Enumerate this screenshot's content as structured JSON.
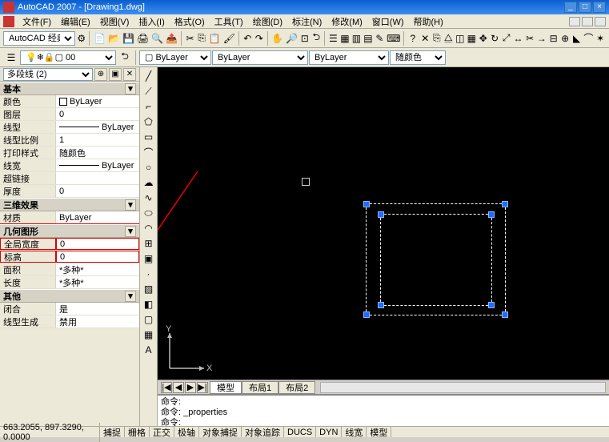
{
  "title": "AutoCAD 2007 - [Drawing1.dwg]",
  "menus": [
    "文件(F)",
    "编辑(E)",
    "视图(V)",
    "插入(I)",
    "格式(O)",
    "工具(T)",
    "绘图(D)",
    "标注(N)",
    "修改(M)",
    "窗口(W)",
    "帮助(H)"
  ],
  "workspace": "AutoCAD 经典",
  "layer_dropdown": "0",
  "linetype_dropdown": "ByLayer",
  "lineweight_dropdown": "ByLayer",
  "color_dropdown": "随颜色",
  "props": {
    "selector": "多段线 (2)",
    "groups": [
      {
        "name": "基本",
        "rows": [
          {
            "label": "颜色",
            "value": "ByLayer",
            "swatch": true
          },
          {
            "label": "图层",
            "value": "0"
          },
          {
            "label": "线型",
            "value": "ByLayer",
            "line": true
          },
          {
            "label": "线型比例",
            "value": "1"
          },
          {
            "label": "打印样式",
            "value": "随颜色"
          },
          {
            "label": "线宽",
            "value": "ByLayer",
            "line": true
          },
          {
            "label": "超链接",
            "value": ""
          },
          {
            "label": "厚度",
            "value": "0"
          }
        ]
      },
      {
        "name": "三维效果",
        "rows": [
          {
            "label": "材质",
            "value": "ByLayer"
          }
        ]
      },
      {
        "name": "几何图形",
        "highlight": true,
        "rows": [
          {
            "label": "全局宽度",
            "value": "0",
            "hl": true
          },
          {
            "label": "标高",
            "value": "0",
            "hl": true
          },
          {
            "label": "面积",
            "value": "*多种*"
          },
          {
            "label": "长度",
            "value": "*多种*"
          }
        ]
      },
      {
        "name": "其他",
        "rows": [
          {
            "label": "闭合",
            "value": "是"
          },
          {
            "label": "线型生成",
            "value": "禁用"
          }
        ]
      }
    ]
  },
  "tabs": {
    "nav": [
      "|◀",
      "◀",
      "▶",
      "▶|"
    ],
    "items": [
      "模型",
      "布局1",
      "布局2"
    ],
    "active": 0
  },
  "cmd_lines": [
    "命令:",
    "命令: _properties",
    "命令:"
  ],
  "status": {
    "coords": "663.2055, 897.3290, 0.0000",
    "buttons": [
      "捕捉",
      "栅格",
      "正交",
      "极轴",
      "对象捕捉",
      "对象追踪",
      "DUCS",
      "DYN",
      "线宽",
      "模型"
    ]
  },
  "ucs": {
    "x": "X",
    "y": "Y"
  }
}
